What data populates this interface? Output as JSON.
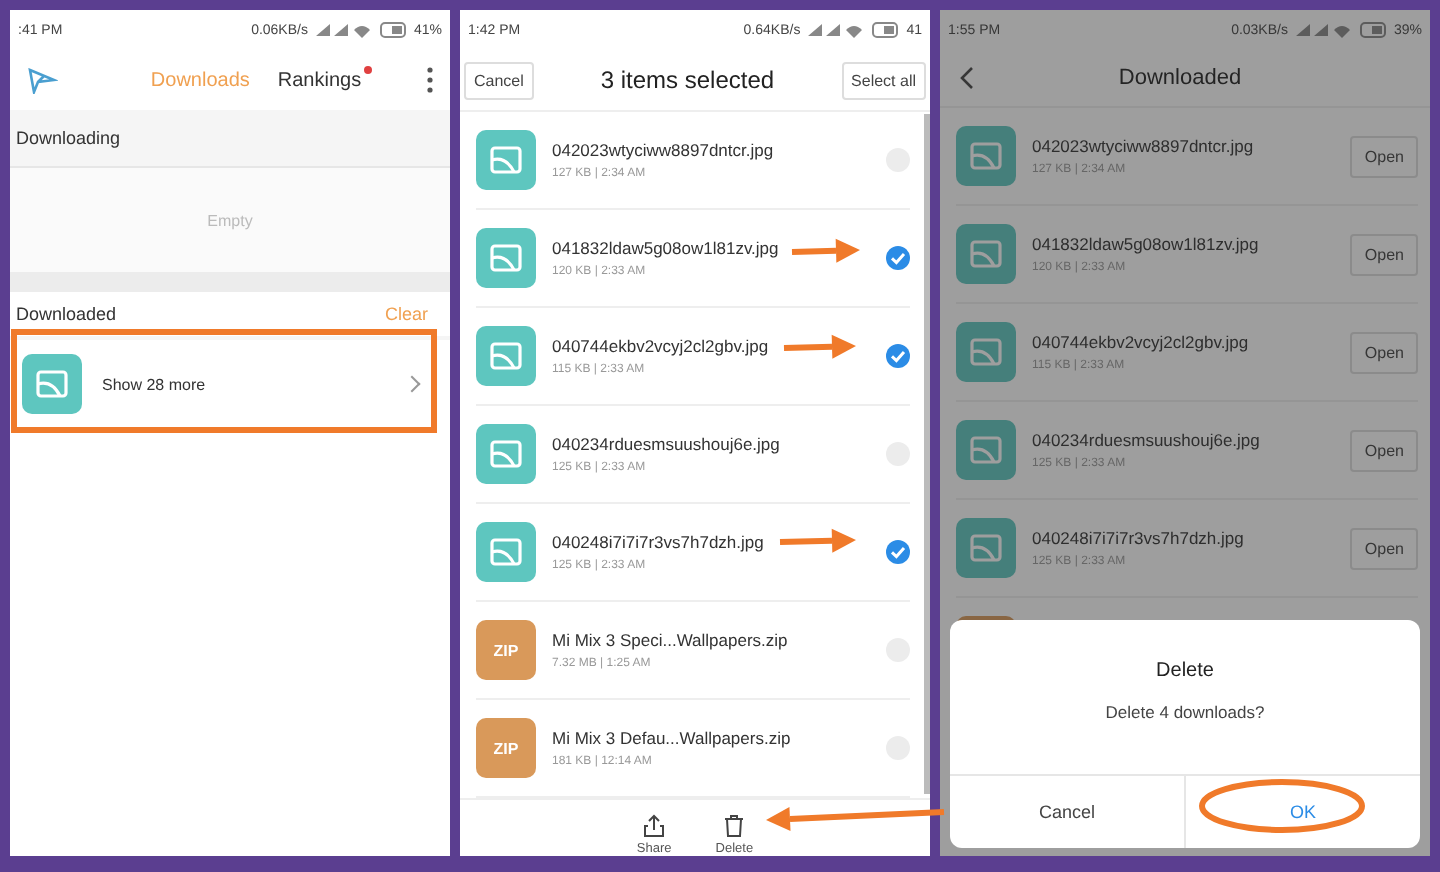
{
  "downloads_screen": {
    "status_bar": {
      "time": ":41 PM",
      "speed": "0.06KB/s",
      "battery": "41%"
    },
    "tabs": [
      {
        "label": "Downloads",
        "selected": true,
        "badge": false
      },
      {
        "label": "Rankings",
        "selected": false,
        "badge": true
      }
    ],
    "downloading": {
      "title": "Downloading",
      "empty_text": "Empty"
    },
    "downloaded": {
      "title": "Downloaded",
      "action": "Clear",
      "more_label": "Show 28 more"
    }
  },
  "selection_screen": {
    "status_bar": {
      "time": "1:42 PM",
      "speed": "0.64KB/s",
      "battery": "41"
    },
    "cancel": "Cancel",
    "title": "3 items selected",
    "select_all": "Select all",
    "files": [
      {
        "kind": "image",
        "name": "042023wtyciww8897dntcr.jpg",
        "meta": "127 KB | 2:34 AM",
        "selected": false
      },
      {
        "kind": "image",
        "name": "041832ldaw5g08ow1l81zv.jpg",
        "meta": "120 KB | 2:33 AM",
        "selected": true
      },
      {
        "kind": "image",
        "name": "040744ekbv2vcyj2cl2gbv.jpg",
        "meta": "115 KB | 2:33 AM",
        "selected": true
      },
      {
        "kind": "image",
        "name": "040234rduesmsuushouj6e.jpg",
        "meta": "125 KB | 2:33 AM",
        "selected": false
      },
      {
        "kind": "image",
        "name": "040248i7i7i7r3vs7h7dzh.jpg",
        "meta": "125 KB | 2:33 AM",
        "selected": true
      },
      {
        "kind": "zip",
        "icon_label": "ZIP",
        "name": "Mi Mix 3 Speci...Wallpapers.zip",
        "meta": "7.32 MB | 1:25 AM",
        "selected": false
      },
      {
        "kind": "zip",
        "icon_label": "ZIP",
        "name": "Mi Mix 3 Defau...Wallpapers.zip",
        "meta": "181 KB | 12:14 AM",
        "selected": false
      }
    ],
    "actions": [
      {
        "kind": "share",
        "label": "Share"
      },
      {
        "kind": "delete",
        "label": "Delete"
      }
    ]
  },
  "confirm_screen": {
    "status_bar": {
      "time": "1:55 PM",
      "speed": "0.03KB/s",
      "battery": "39%"
    },
    "title": "Downloaded",
    "files": [
      {
        "kind": "image",
        "name": "042023wtyciww8897dntcr.jpg",
        "meta": "127 KB | 2:34 AM",
        "button": "Open"
      },
      {
        "kind": "image",
        "name": "041832ldaw5g08ow1l81zv.jpg",
        "meta": "120 KB | 2:33 AM",
        "button": "Open"
      },
      {
        "kind": "image",
        "name": "040744ekbv2vcyj2cl2gbv.jpg",
        "meta": "115 KB | 2:33 AM",
        "button": "Open"
      },
      {
        "kind": "image",
        "name": "040234rduesmsuushouj6e.jpg",
        "meta": "125 KB | 2:33 AM",
        "button": "Open"
      },
      {
        "kind": "image",
        "name": "040248i7i7i7r3vs7h7dzh.jpg",
        "meta": "125 KB | 2:33 AM",
        "button": "Open"
      },
      {
        "kind": "zip"
      }
    ],
    "dialog": {
      "title": "Delete",
      "message": "Delete 4 downloads?",
      "buttons": [
        {
          "label": "Cancel",
          "primary": false
        },
        {
          "label": "OK",
          "primary": true
        }
      ]
    }
  }
}
